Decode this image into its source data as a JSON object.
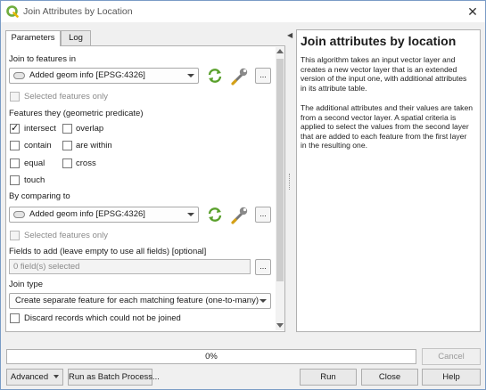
{
  "window": {
    "title": "Join Attributes by Location",
    "brand_color": "#6fad3e"
  },
  "tabs": [
    {
      "label": "Parameters"
    },
    {
      "label": "Log"
    }
  ],
  "params": {
    "join_label": "Join to features in",
    "join_layer": "Added geom info [EPSG:4326]",
    "selected_only_label": "Selected features only",
    "predicate_label": "Features they (geometric predicate)",
    "predicates": {
      "intersect": {
        "label": "intersect",
        "checked": true
      },
      "overlap": {
        "label": "overlap",
        "checked": false
      },
      "contain": {
        "label": "contain",
        "checked": false
      },
      "are_within": {
        "label": "are within",
        "checked": false
      },
      "equal": {
        "label": "equal",
        "checked": false
      },
      "cross": {
        "label": "cross",
        "checked": false
      },
      "touch": {
        "label": "touch",
        "checked": false
      }
    },
    "compare_label": "By comparing to",
    "compare_layer": "Added geom info [EPSG:4326]",
    "selected_only_label2": "Selected features only",
    "fields_label": "Fields to add (leave empty to use all fields) [optional]",
    "fields_value": "0 field(s) selected",
    "join_type_label": "Join type",
    "join_type_value": "Create separate feature for each matching feature (one-to-many)",
    "discard_label": "Discard records which could not be joined",
    "ellipsis": "..."
  },
  "help": {
    "title": "Join attributes by location",
    "p1": "This algorithm takes an input vector layer and creates a new vector layer that is an extended version of the input one, with additional attributes in its attribute table.",
    "p2": "The additional attributes and their values are taken from a second vector layer. A spatial criteria is applied to select the values from the second layer that are added to each feature from the first layer in the resulting one."
  },
  "progress": {
    "value": 0,
    "text": "0%"
  },
  "buttons": {
    "cancel": "Cancel",
    "advanced": "Advanced",
    "batch": "Run as Batch Process...",
    "run": "Run",
    "close": "Close",
    "help": "Help"
  }
}
